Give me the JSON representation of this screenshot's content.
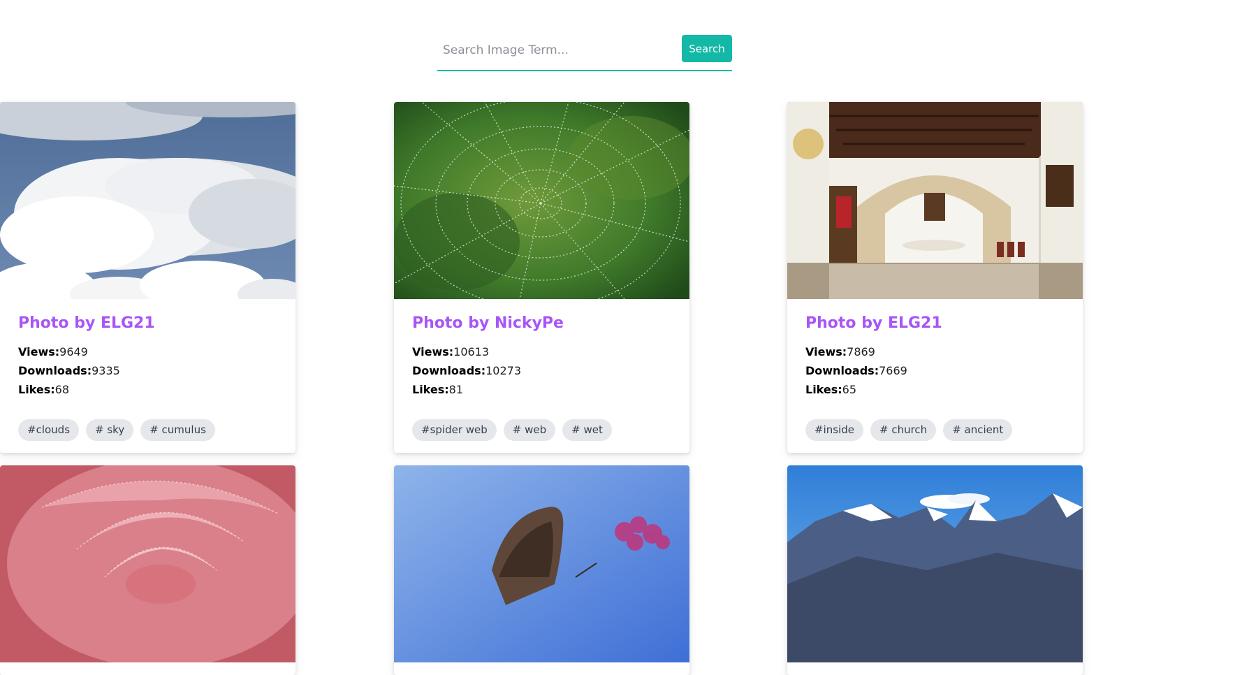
{
  "search": {
    "placeholder": "Search Image Term...",
    "button_label": "Search"
  },
  "labels": {
    "views": "Views:",
    "downloads": "Downloads:",
    "likes": "Likes:"
  },
  "cards": [
    {
      "title": "Photo by ELG21",
      "views": "9649",
      "downloads": "9335",
      "likes": "68",
      "tags": [
        "#clouds",
        "# sky",
        "# cumulus"
      ]
    },
    {
      "title": "Photo by NickyPe",
      "views": "10613",
      "downloads": "10273",
      "likes": "81",
      "tags": [
        "#spider web",
        "# web",
        "# wet"
      ]
    },
    {
      "title": "Photo by ELG21",
      "views": "7869",
      "downloads": "7669",
      "likes": "65",
      "tags": [
        "#inside",
        "# church",
        "# ancient"
      ]
    }
  ],
  "colors": {
    "accent": "#14b8a6",
    "title": "#a855f7",
    "tag_bg": "#e5e7eb"
  }
}
